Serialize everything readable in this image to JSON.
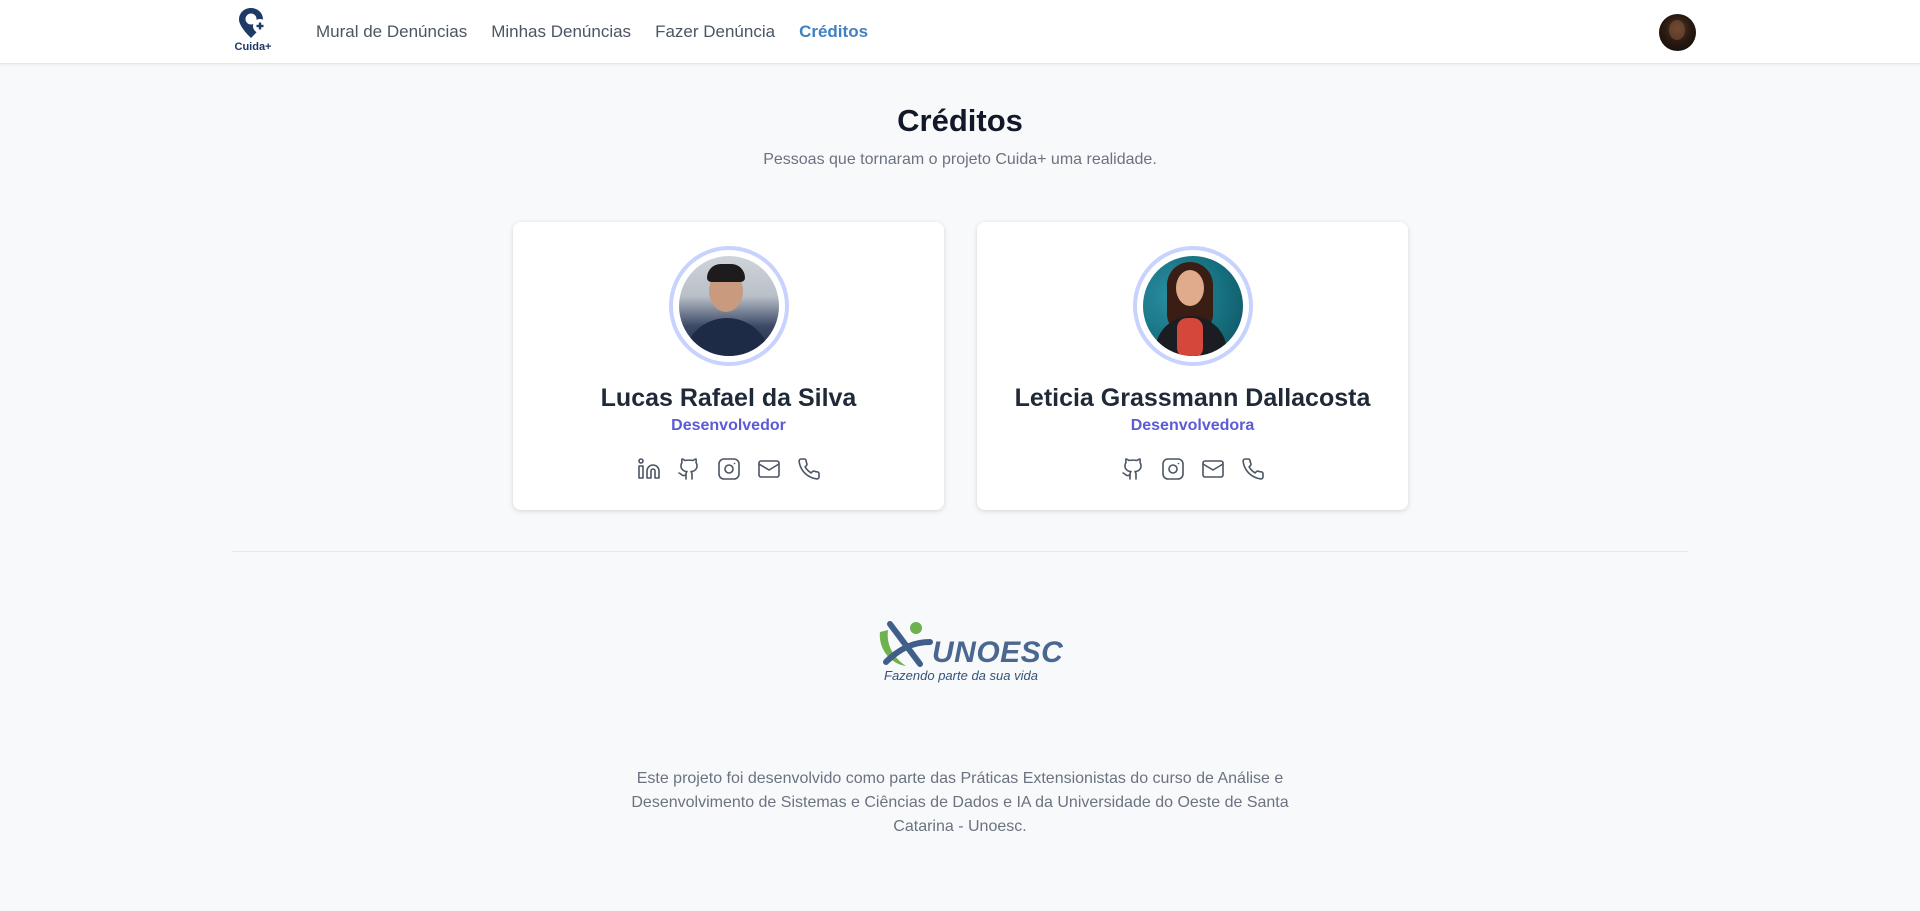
{
  "header": {
    "brand": "Cuida+",
    "nav": [
      {
        "label": "Mural de Denúncias",
        "active": false
      },
      {
        "label": "Minhas Denúncias",
        "active": false
      },
      {
        "label": "Fazer Denúncia",
        "active": false
      },
      {
        "label": "Créditos",
        "active": true
      }
    ],
    "accent_color": "#3f82bf"
  },
  "page": {
    "title": "Créditos",
    "subtitle": "Pessoas que tornaram o projeto Cuida+ uma realidade."
  },
  "credits": [
    {
      "name": "Lucas Rafael da Silva",
      "role": "Desenvolvedor",
      "socials": [
        "linkedin-icon",
        "github-icon",
        "instagram-icon",
        "mail-icon",
        "phone-icon"
      ]
    },
    {
      "name": "Leticia Grassmann Dallacosta",
      "role": "Desenvolvedora",
      "socials": [
        "github-icon",
        "instagram-icon",
        "mail-icon",
        "phone-icon"
      ]
    }
  ],
  "footer": {
    "logo_word": "UNOESC",
    "logo_tagline": "Fazendo parte da sua vida",
    "text": "Este projeto foi desenvolvido como parte das Práticas Extensionistas do curso de Análise e Desenvolvimento de Sistemas e Ciências de Dados e IA da Universidade do Oeste de Santa Catarina - Unoesc."
  }
}
